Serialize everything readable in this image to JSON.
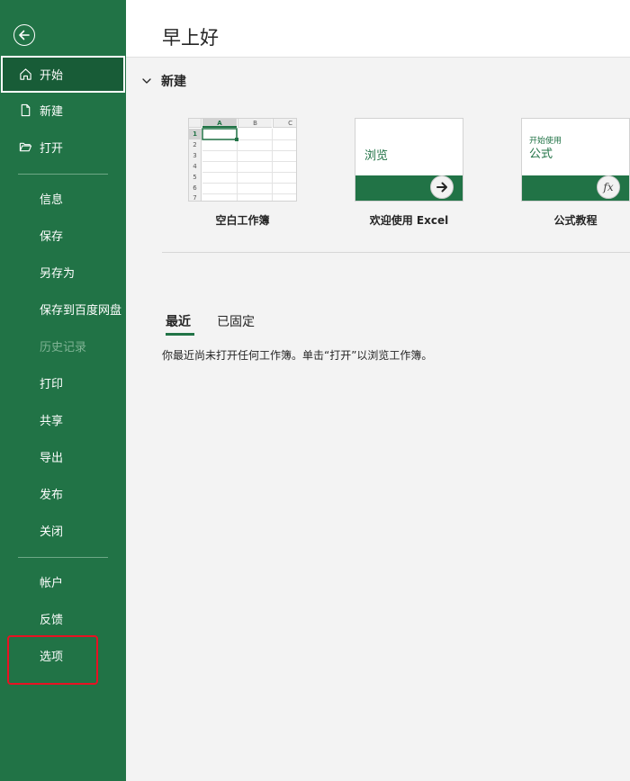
{
  "sidebar": {
    "items": [
      {
        "label": "开始",
        "icon": "home-icon"
      },
      {
        "label": "新建",
        "icon": "new-file-icon"
      },
      {
        "label": "打开",
        "icon": "folder-open-icon"
      },
      {
        "label": "信息"
      },
      {
        "label": "保存"
      },
      {
        "label": "另存为"
      },
      {
        "label": "保存到百度网盘"
      },
      {
        "label": "历史记录"
      },
      {
        "label": "打印"
      },
      {
        "label": "共享"
      },
      {
        "label": "导出"
      },
      {
        "label": "发布"
      },
      {
        "label": "关闭"
      },
      {
        "label": "帐户"
      },
      {
        "label": "反馈"
      },
      {
        "label": "选项"
      }
    ]
  },
  "header": {
    "greeting": "早上好"
  },
  "new_section": {
    "title": "新建",
    "templates": [
      {
        "caption": "空白工作簿",
        "columns": [
          "A",
          "B",
          "C"
        ],
        "rows": [
          "1",
          "2",
          "3",
          "4",
          "5",
          "6",
          "7"
        ]
      },
      {
        "caption": "欢迎使用 Excel",
        "thumb_text": "浏览"
      },
      {
        "caption": "公式教程",
        "thumb_small": "开始使用",
        "thumb_big": "公式",
        "thumb_symbol": "fx"
      }
    ]
  },
  "recent": {
    "tabs": [
      "最近",
      "已固定"
    ],
    "empty_message": "你最近尚未打开任何工作簿。单击“打开”以浏览工作簿。"
  },
  "colors": {
    "brand_green": "#217346",
    "active_green": "#185c37",
    "highlight_red": "#e81123"
  }
}
